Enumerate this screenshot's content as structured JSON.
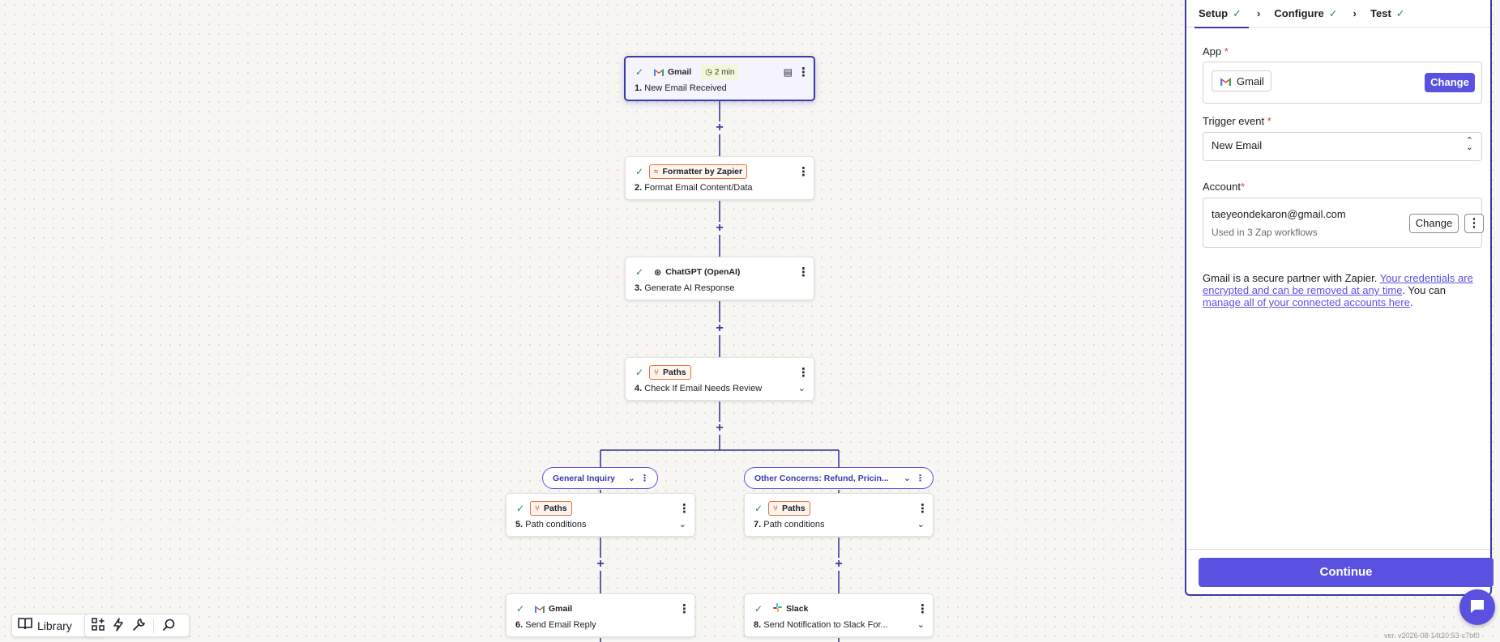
{
  "canvas": {
    "steps": [
      {
        "app": "Gmail",
        "number": "1.",
        "title": "New Email Received",
        "badge": "2 min"
      },
      {
        "app": "Formatter by Zapier",
        "number": "2.",
        "title": "Format Email Content/Data"
      },
      {
        "app": "ChatGPT (OpenAI)",
        "number": "3.",
        "title": "Generate AI Response"
      },
      {
        "app": "Paths",
        "number": "4.",
        "title": "Check If Email Needs Review"
      },
      {
        "app": "Paths",
        "number": "5.",
        "title": "Path conditions"
      },
      {
        "app": "Gmail",
        "number": "6.",
        "title": "Send Email Reply"
      },
      {
        "app": "Paths",
        "number": "7.",
        "title": "Path conditions"
      },
      {
        "app": "Slack",
        "number": "8.",
        "title": "Send Notification to Slack For..."
      }
    ],
    "paths": [
      {
        "label": "General Inquiry"
      },
      {
        "label": "Other Concerns: Refund, Pricin..."
      }
    ]
  },
  "toolbar": {
    "library_label": "Library"
  },
  "panel": {
    "tabs": [
      {
        "label": "Setup"
      },
      {
        "label": "Configure"
      },
      {
        "label": "Test"
      }
    ],
    "app": {
      "label": "App",
      "required": "*",
      "value": "Gmail",
      "change_label": "Change"
    },
    "trigger": {
      "label": "Trigger event",
      "required": "*",
      "value": "New Email"
    },
    "account": {
      "label": "Account",
      "required": "*",
      "email": "taeyeondekaron@gmail.com",
      "usage": "Used in 3 Zap workflows",
      "change_label": "Change"
    },
    "info": {
      "prefix": "Gmail is a secure partner with Zapier. ",
      "link1": "Your credentials are encrypted and can be removed at any time",
      "middle": ". You can ",
      "link2": "manage all of your connected accounts here",
      "suffix": "."
    },
    "continue_label": "Continue"
  },
  "version": "ver. v2026-08-14t20:53-c7bf0"
}
